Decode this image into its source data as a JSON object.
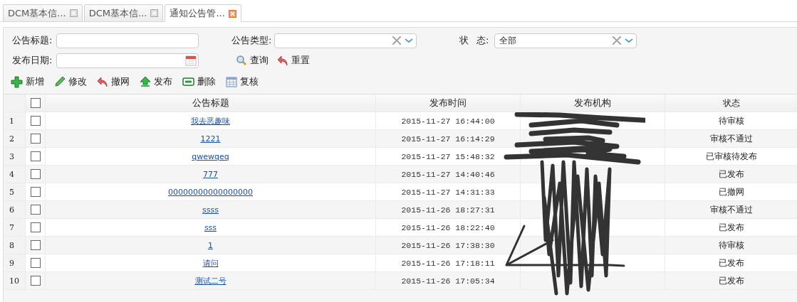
{
  "tabs": [
    {
      "label": "DCM基本信...",
      "selected": false
    },
    {
      "label": "DCM基本信...",
      "selected": false
    },
    {
      "label": "通知公告管...",
      "selected": true
    }
  ],
  "filters": {
    "title_label": "公告标题:",
    "type_label": "公告类型:",
    "status_label_1": "状",
    "status_label_2": "态:",
    "status_value": "全部",
    "date_label": "发布日期:",
    "query": "查询",
    "reset": "重置"
  },
  "toolbar": [
    {
      "kind": "add",
      "label": "新增"
    },
    {
      "kind": "edit",
      "label": "修改"
    },
    {
      "kind": "withdraw",
      "label": "撤网"
    },
    {
      "kind": "publish",
      "label": "发布"
    },
    {
      "kind": "delete",
      "label": "删除"
    },
    {
      "kind": "review",
      "label": "复核"
    }
  ],
  "table": {
    "columns": [
      "公告标题",
      "发布时间",
      "发布机构",
      "状态"
    ],
    "select_all_checked": false,
    "rows": [
      {
        "index": "1",
        "checked": false,
        "title": "我去恶趣味",
        "time": "2015-11-27 16:44:00",
        "status": "待审核"
      },
      {
        "index": "2",
        "checked": false,
        "title": "1221",
        "time": "2015-11-27 16:14:29",
        "status": "审核不通过"
      },
      {
        "index": "3",
        "checked": false,
        "title": "qwewqeq",
        "time": "2015-11-27 15:48:32",
        "status": "已审核待发布"
      },
      {
        "index": "4",
        "checked": false,
        "title": "777",
        "time": "2015-11-27 14:40:46",
        "status": "已发布"
      },
      {
        "index": "5",
        "checked": false,
        "title": "00000000000000000",
        "time": "2015-11-27 14:31:33",
        "status": "已撤网"
      },
      {
        "index": "6",
        "checked": false,
        "title": "ssss",
        "time": "2015-11-26 18:27:31",
        "status": "审核不通过"
      },
      {
        "index": "7",
        "checked": false,
        "title": "sss",
        "time": "2015-11-26 18:22:40",
        "status": "已发布"
      },
      {
        "index": "8",
        "checked": false,
        "title": "1",
        "time": "2015-11-26 17:38:30",
        "status": "待审核"
      },
      {
        "index": "9",
        "checked": false,
        "title": "请问",
        "time": "2015-11-26 17:18:11",
        "status": "已发布"
      },
      {
        "index": "10",
        "checked": false,
        "title": "测试二号",
        "time": "2015-11-26 17:05:34",
        "status": "已发布"
      }
    ]
  }
}
